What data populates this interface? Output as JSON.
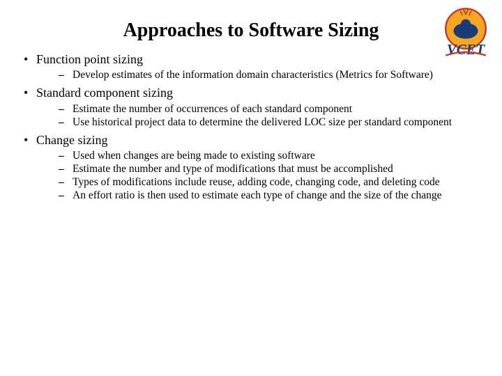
{
  "title": "Approaches to Software Sizing",
  "bullets": [
    {
      "text": "Function point sizing",
      "sub": [
        "Develop estimates of the information domain characteristics (Metrics for Software)"
      ]
    },
    {
      "text": "Standard component sizing",
      "sub": [
        "Estimate the number of occurrences of each standard component",
        "Use historical project data to determine the delivered LOC size per standard component"
      ]
    },
    {
      "text": "Change sizing",
      "sub": [
        "Used when changes are being made to existing software",
        "Estimate the number and type of modifications that must be accomplished",
        "Types of modifications include reuse, adding code, changing code, and deleting code",
        "An effort ratio is then used to estimate each type of change and the size of the change"
      ]
    }
  ]
}
